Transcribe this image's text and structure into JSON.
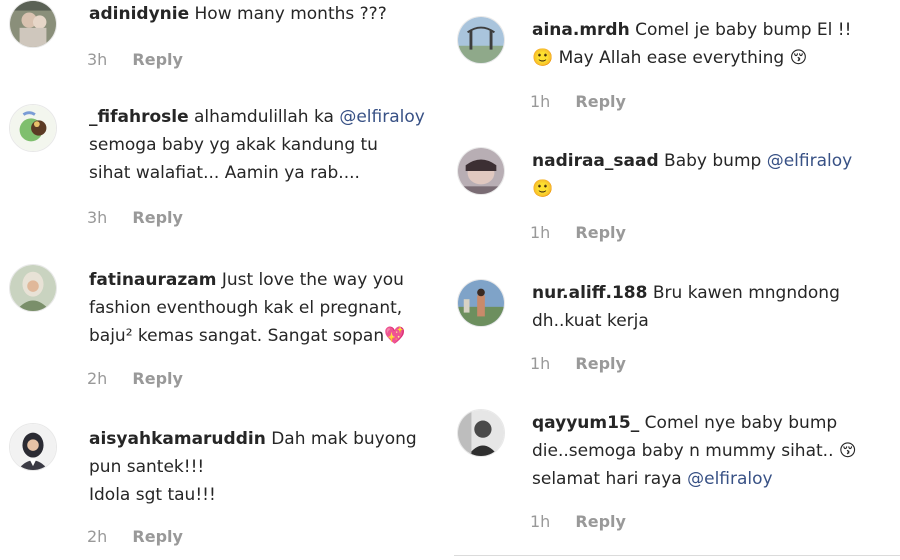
{
  "left_comments": [
    {
      "username": "adinidynie",
      "text": "How many months ???",
      "time": "3h",
      "reply": "Reply"
    },
    {
      "username": "_fifahrosle",
      "text_before": "alhamdulillah ka",
      "mention": "@elfiraloy",
      "line2": "semoga baby yg akak kandung tu",
      "line3": "sihat walafiat... Aamin ya rab....",
      "time": "3h",
      "reply": "Reply"
    },
    {
      "username": "fatinaurazam",
      "text_before": "Just love the way you",
      "line2": "fashion eventhough kak el pregnant,",
      "line3": "baju² kemas sangat. Sangat sopan",
      "emoji": "💖",
      "time": "2h",
      "reply": "Reply"
    },
    {
      "username": "aisyahkamaruddin",
      "text_before": "Dah mak buyong",
      "line2": "pun santek!!!",
      "line3": "Idola sgt tau!!!",
      "time": "2h",
      "reply": "Reply"
    }
  ],
  "right_comments": [
    {
      "username": "aina.mrdh",
      "text_before": "Comel je baby bump El !!",
      "emoji1": "🙂",
      "line2": "May Allah ease everything",
      "emoji2": "😚",
      "time": "1h",
      "reply": "Reply"
    },
    {
      "username": "nadiraa_saad",
      "text_before": "Baby bump",
      "mention": "@elfiraloy",
      "emoji": "🙂",
      "time": "1h",
      "reply": "Reply"
    },
    {
      "username": "nur.aliff.188",
      "text_before": "Bru kawen mngndong",
      "line2": "dh..kuat kerja",
      "time": "1h",
      "reply": "Reply"
    },
    {
      "username": "qayyum15_",
      "text_before": "Comel nye baby bump",
      "line2": "die..semoga baby n mummy sihat..",
      "emoji": "😚",
      "line3_before": "selamat hari raya",
      "mention": "@elfiraloy",
      "time": "1h",
      "reply": "Reply"
    }
  ]
}
